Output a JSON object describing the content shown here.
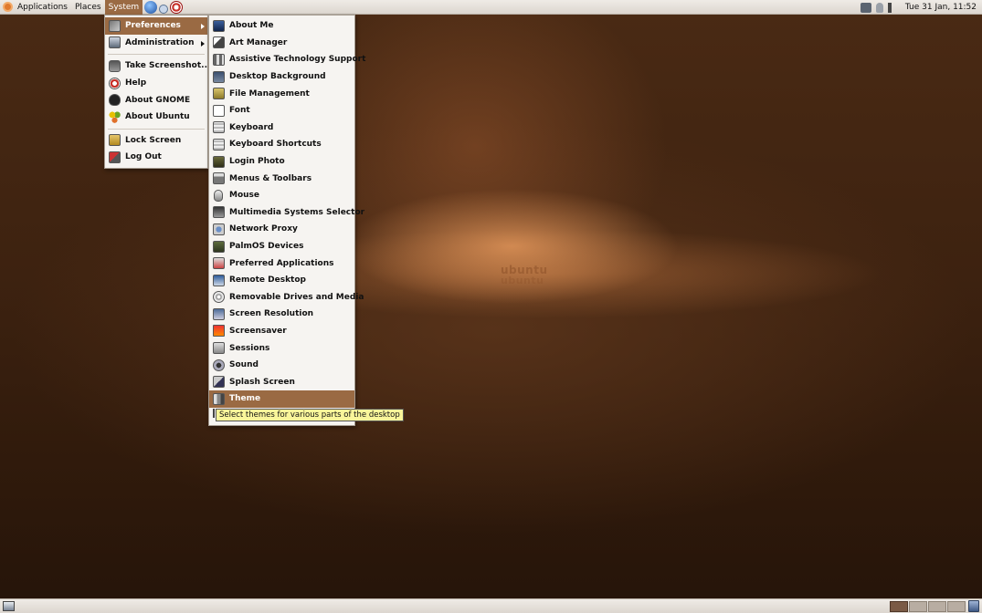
{
  "top_panel": {
    "menus": [
      "Applications",
      "Places",
      "System"
    ],
    "launchers": [
      "web-browser-icon",
      "mail-icon",
      "help-icon"
    ],
    "clock": "Tue 31 Jan, 11:52"
  },
  "system_menu": {
    "items": [
      {
        "label": "Preferences",
        "icon": "tools-icon",
        "submenu": true,
        "highlighted": true
      },
      {
        "label": "Administration",
        "icon": "admin-icon",
        "submenu": true
      },
      {
        "label": "Take Screenshot...",
        "icon": "camera-icon"
      },
      {
        "label": "Help",
        "icon": "help-icon"
      },
      {
        "label": "About GNOME",
        "icon": "gnome-icon"
      },
      {
        "label": "About Ubuntu",
        "icon": "ubuntu-icon"
      },
      {
        "label": "Lock Screen",
        "icon": "lock-icon"
      },
      {
        "label": "Log Out",
        "icon": "logout-icon"
      }
    ]
  },
  "preferences_menu": {
    "items": [
      {
        "label": "About Me",
        "icon": "user-icon"
      },
      {
        "label": "Art Manager",
        "icon": "art-icon"
      },
      {
        "label": "Assistive Technology Support",
        "icon": "accessibility-icon"
      },
      {
        "label": "Desktop Background",
        "icon": "desktop-icon"
      },
      {
        "label": "File Management",
        "icon": "file-icon"
      },
      {
        "label": "Font",
        "icon": "font-icon"
      },
      {
        "label": "Keyboard",
        "icon": "keyboard-icon"
      },
      {
        "label": "Keyboard Shortcuts",
        "icon": "keyboard-shortcuts-icon"
      },
      {
        "label": "Login Photo",
        "icon": "photo-icon"
      },
      {
        "label": "Menus & Toolbars",
        "icon": "menus-icon"
      },
      {
        "label": "Mouse",
        "icon": "mouse-icon"
      },
      {
        "label": "Multimedia Systems Selector",
        "icon": "multimedia-icon"
      },
      {
        "label": "Network Proxy",
        "icon": "network-icon"
      },
      {
        "label": "PalmOS Devices",
        "icon": "palm-icon"
      },
      {
        "label": "Preferred Applications",
        "icon": "preferred-apps-icon"
      },
      {
        "label": "Remote Desktop",
        "icon": "remote-desktop-icon"
      },
      {
        "label": "Removable Drives and Media",
        "icon": "drive-icon"
      },
      {
        "label": "Screen Resolution",
        "icon": "resolution-icon"
      },
      {
        "label": "Screensaver",
        "icon": "screensaver-icon"
      },
      {
        "label": "Sessions",
        "icon": "sessions-icon"
      },
      {
        "label": "Sound",
        "icon": "sound-icon"
      },
      {
        "label": "Splash Screen",
        "icon": "splash-icon"
      },
      {
        "label": "Theme",
        "icon": "theme-icon",
        "highlighted": true
      }
    ]
  },
  "tooltip": "Select themes for various parts of the desktop",
  "watermark": {
    "line1": "ubuntu",
    "line2": "ubuntu"
  },
  "colors": {
    "highlight": "#9a6a43",
    "menu_bg": "#f6f4f1",
    "tooltip_bg": "#f9f59a"
  }
}
